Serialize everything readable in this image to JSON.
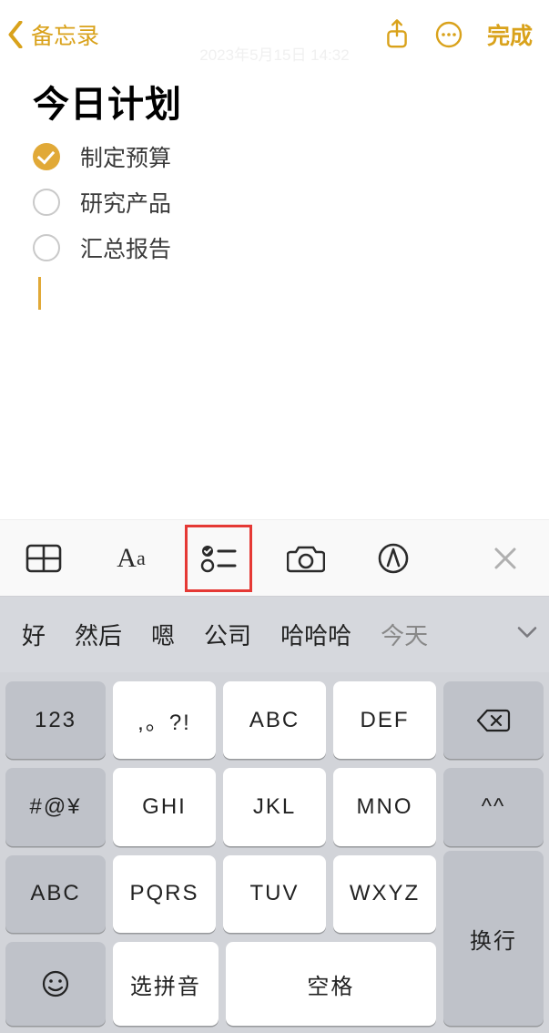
{
  "nav": {
    "back_label": "备忘录",
    "done_label": "完成"
  },
  "meta": {
    "timestamp": "2023年5月15日 14:32"
  },
  "note": {
    "title": "今日计划",
    "items": [
      {
        "text": "制定预算",
        "checked": true
      },
      {
        "text": "研究产品",
        "checked": false
      },
      {
        "text": "汇总报告",
        "checked": false
      }
    ]
  },
  "format_bar": {
    "aa_big": "A",
    "aa_small": "a"
  },
  "suggestions": [
    "好",
    "然后",
    "嗯",
    "公司",
    "哈哈哈",
    "今天"
  ],
  "keyboard": {
    "side": [
      "123",
      "#@¥",
      "ABC"
    ],
    "rows": [
      [
        ",。?!",
        "ABC",
        "DEF"
      ],
      [
        "GHI",
        "JKL",
        "MNO"
      ],
      [
        "PQRS",
        "TUV",
        "WXYZ"
      ]
    ],
    "emoji": "☺",
    "select_pinyin": "选拼音",
    "space": "空格",
    "face_key": "^^",
    "enter": "换行"
  }
}
